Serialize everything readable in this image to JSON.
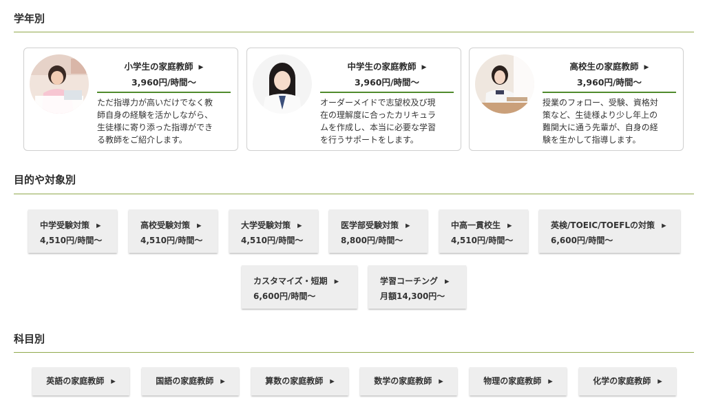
{
  "sections": {
    "grade": "学年別",
    "purpose": "目的や対象別",
    "subject": "科目別"
  },
  "icons": {
    "arrow": "caret-right-icon"
  },
  "arrow_glyph": "▶",
  "grade_cards": [
    {
      "title": "小学生の家庭教師",
      "price": "3,960円/時間～",
      "lines": [
        "ただ指導力が高いだけでなく教",
        "師自身の経験を活かしながら、",
        "生徒様に寄り添った指導ができ",
        "る教師をご紹介します。"
      ]
    },
    {
      "title": "中学生の家庭教師",
      "price": "3,960円/時間～",
      "lines": [
        "オーダーメイドで志望校及び現",
        "在の理解度に合ったカリキュラ",
        "ムを作成し、本当に必要な学習",
        "を行うサポートをします。"
      ]
    },
    {
      "title": "高校生の家庭教師",
      "price": "3,960円/時間～",
      "lines": [
        "授業のフォロー、受験、資格対",
        "策など、生徒様より少し年上の",
        "難関大に通う先輩が、自身の経",
        "験を生かして指導します。"
      ]
    }
  ],
  "purpose_items": [
    {
      "title": "中学受験対策",
      "price": "4,510円/時間～"
    },
    {
      "title": "高校受験対策",
      "price": "4,510円/時間～"
    },
    {
      "title": "大学受験対策",
      "price": "4,510円/時間～"
    },
    {
      "title": "医学部受験対策",
      "price": "8,800円/時間～"
    },
    {
      "title": "中高一貫校生",
      "price": "4,510円/時間～"
    },
    {
      "title": "英検/TOEIC/TOEFLの対策",
      "price": "6,600円/時間～"
    },
    {
      "title": "カスタマイズ・短期",
      "price": "6,600円/時間～"
    },
    {
      "title": "学習コーチング",
      "price": "月額14,300円～"
    }
  ],
  "subject_items": [
    {
      "title": "英語の家庭教師"
    },
    {
      "title": "国語の家庭教師"
    },
    {
      "title": "算数の家庭教師"
    },
    {
      "title": "数学の家庭教師"
    },
    {
      "title": "物理の家庭教師"
    },
    {
      "title": "化学の家庭教師"
    }
  ]
}
